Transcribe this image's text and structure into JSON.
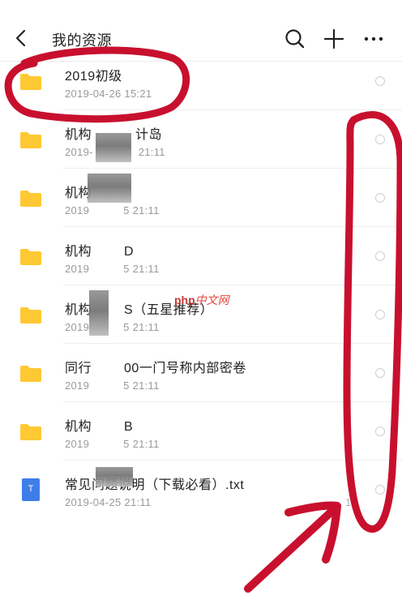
{
  "header": {
    "title": "我的资源",
    "icons": [
      "back-icon",
      "search-icon",
      "plus-icon",
      "more-icon"
    ]
  },
  "files": [
    {
      "name": "2019初级",
      "meta": "2019-04-26 15:21",
      "type": "folder"
    },
    {
      "name": "机构",
      "name_tail": "计岛",
      "meta": "2019-",
      "meta_tail": "21:11",
      "type": "folder"
    },
    {
      "name": "机构",
      "name_tail": "",
      "meta": "2019",
      "meta_tail": "5 21:11",
      "type": "folder"
    },
    {
      "name": "机构",
      "name_tail": "D",
      "meta": "2019",
      "meta_tail": "5 21:11",
      "type": "folder"
    },
    {
      "name": "机构",
      "name_tail": "S（五星推荐）",
      "meta": "2019",
      "meta_tail": "5 21:11",
      "type": "folder"
    },
    {
      "name": "同行",
      "name_tail": "00一门号称内部密卷",
      "meta": "2019",
      "meta_tail": "5 21:11",
      "type": "folder"
    },
    {
      "name": "机构",
      "name_tail": "B",
      "meta": "2019",
      "meta_tail": "5 21:11",
      "type": "folder"
    },
    {
      "name": "常见问题说明（下载必看）.txt",
      "meta": "2019-04-25 21:11",
      "type": "txt",
      "size": "1"
    }
  ],
  "txt_icon_label": "T",
  "watermark": {
    "brand": "php",
    "text": "中文网"
  },
  "colors": {
    "folder": "#FFC933",
    "txt": "#3F7EE8",
    "annotation": "#C8102E"
  }
}
